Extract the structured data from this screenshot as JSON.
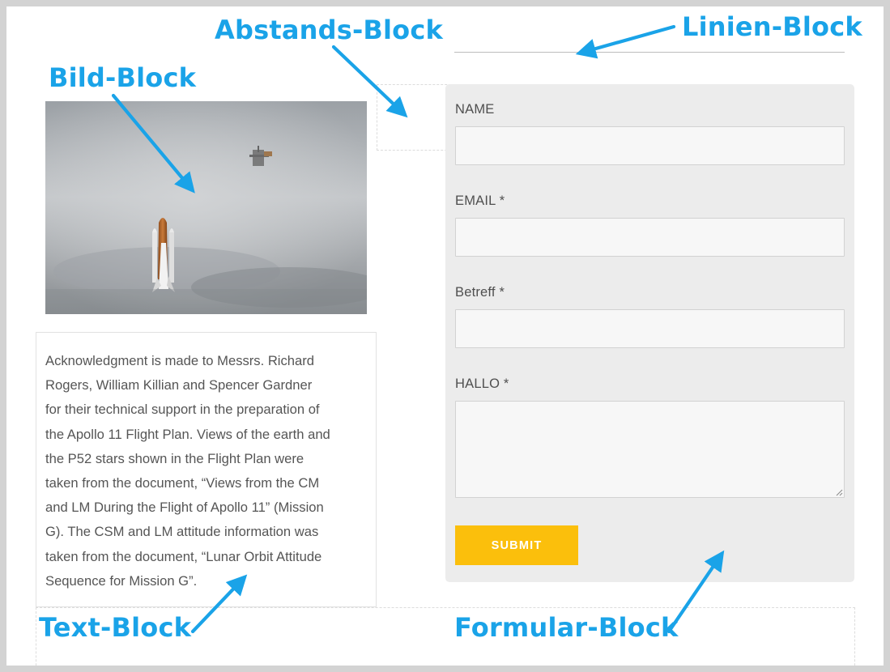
{
  "callouts": {
    "abstands": "Abstands-Block",
    "linien": "Linien-Block",
    "bild": "Bild-Block",
    "text": "Text-Block",
    "formular": "Formular-Block"
  },
  "text_block": {
    "lines": [
      "Acknowledgment is made to Messrs. Richard",
      "Rogers, William Killian and Spencer Gardner",
      "for their technical support in the preparation of",
      "the Apollo 11 Flight Plan. Views of the earth and",
      "the P52 stars shown in the Flight Plan were",
      "taken from the document, “Views from the CM",
      "and LM During the Flight of Apollo 11” (Mission",
      "G). The CSM and LM attitude information was",
      "taken from the document, “Lunar Orbit Attitude",
      "Sequence for Mission G”."
    ]
  },
  "form": {
    "fields": [
      {
        "label": "NAME",
        "value": ""
      },
      {
        "label": "EMAIL *",
        "value": ""
      },
      {
        "label": "Betreff *",
        "value": ""
      },
      {
        "label": "HALLO *",
        "value": ""
      }
    ],
    "submit_label": "SUBMIT"
  },
  "colors": {
    "callout": "#1aa3e8",
    "submit_bg": "#fbbf0c",
    "form_bg": "#ececec"
  },
  "icons": {
    "arrow": "callout-arrow-icon",
    "resize": "resize-grip-icon"
  }
}
